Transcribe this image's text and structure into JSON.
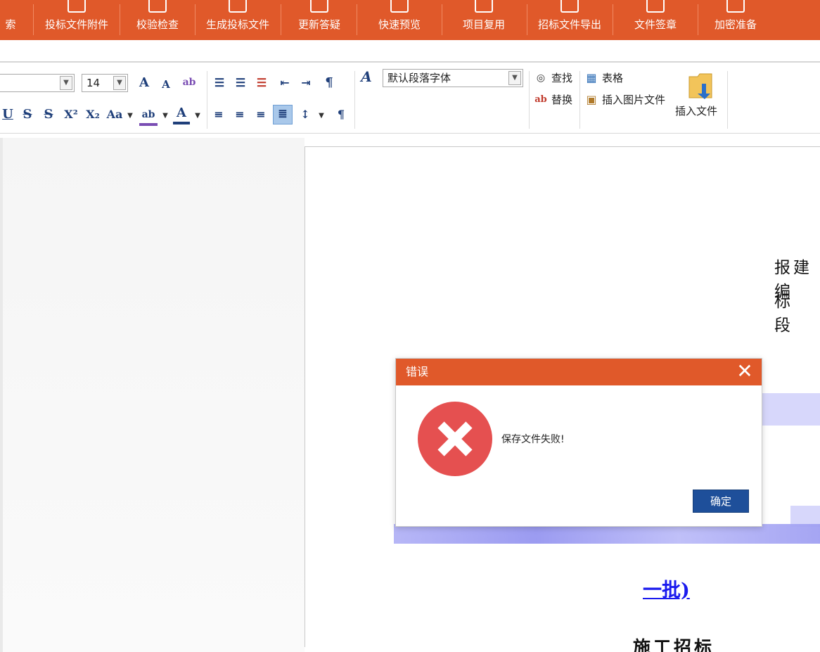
{
  "topbar": {
    "items": [
      {
        "label": "索"
      },
      {
        "label": "投标文件附件"
      },
      {
        "label": "校验检查"
      },
      {
        "label": "生成投标文件"
      },
      {
        "label": "更新答疑"
      },
      {
        "label": "快速预览"
      },
      {
        "label": "项目复用"
      },
      {
        "label": "招标文件导出"
      },
      {
        "label": "文件签章"
      },
      {
        "label": "加密准备"
      }
    ]
  },
  "ribbon": {
    "font_size_value": "14",
    "paragraph_style_value": "默认段落字体",
    "find_label": "查找",
    "replace_label": "替换",
    "table_label": "表格",
    "insert_image_label": "插入图片文件",
    "insert_file_label": "插入文件"
  },
  "document": {
    "line1": "报建编",
    "line2": "标 段",
    "link_bottom": "一批)",
    "heading_bottom": "施工招标"
  },
  "dialog": {
    "title": "错误",
    "close_glyph": "✕",
    "message": "保存文件失败!",
    "ok_label": "确定"
  },
  "colors": {
    "accent_orange": "#e0592a",
    "ok_button_blue": "#1e4f9a",
    "error_red": "#e55050",
    "link_blue": "#1a1aee"
  }
}
